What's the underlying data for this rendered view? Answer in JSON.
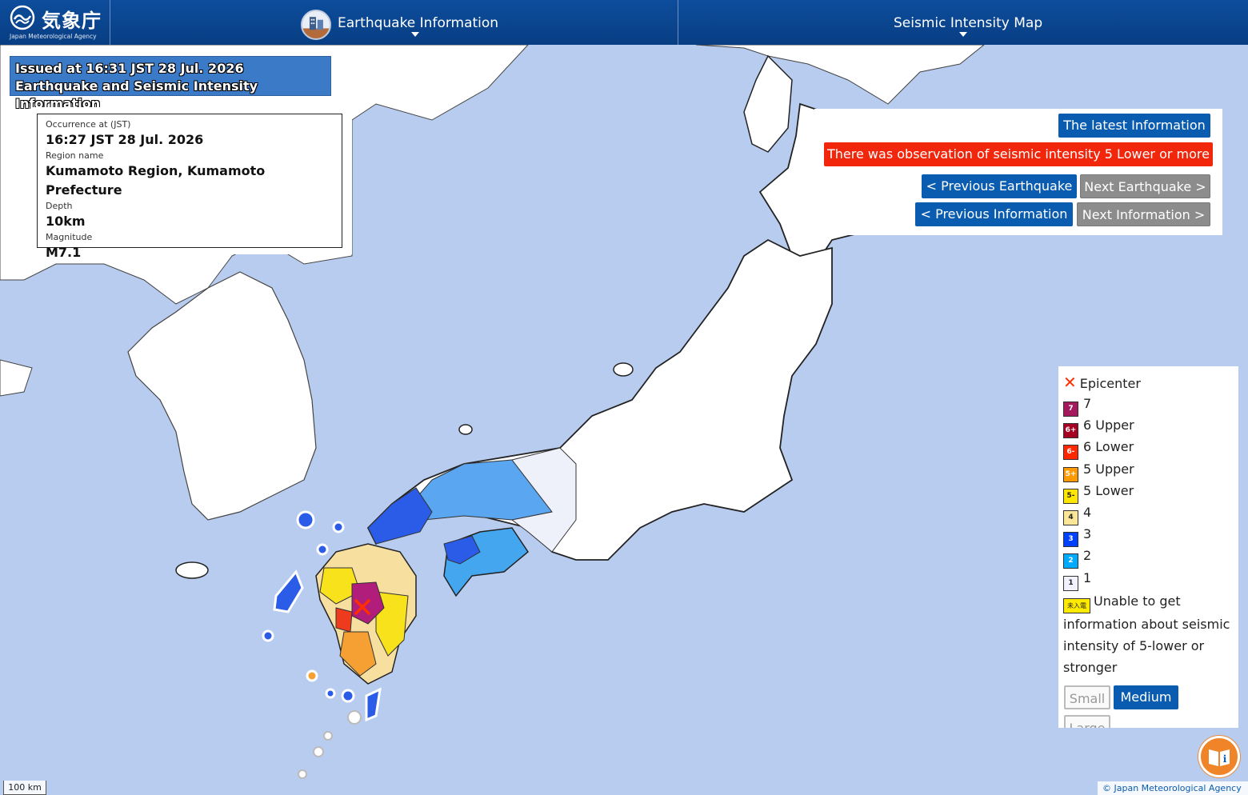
{
  "header": {
    "logo_kanji": "気象庁",
    "logo_en": "Japan Meteorological Agency",
    "tab_earthquake": "Earthquake Information",
    "tab_map": "Seismic Intensity Map"
  },
  "issued": {
    "line1": "Issued at 16:31 JST 28 Jul. 2026",
    "line2": "Earthquake and Seismic Intensity Information"
  },
  "info": {
    "occurrence_label": "Occurrence at (JST)",
    "occurrence_value": "16:27 JST 28 Jul. 2026",
    "region_label": "Region name",
    "region_value": "Kumamoto Region, Kumamoto Prefecture",
    "depth_label": "Depth",
    "depth_value": "10km",
    "magnitude_label": "Magnitude",
    "magnitude_value": "M7.1"
  },
  "nav": {
    "latest": "The latest Information",
    "alert": "There was observation of seismic intensity 5 Lower or more",
    "prev_eq": "< Previous Earthquake",
    "next_eq": "Next Earthquake >",
    "prev_info": "< Previous Information",
    "next_info": "Next Information >"
  },
  "legend": {
    "epicenter": "Epicenter",
    "items": [
      {
        "badge": "7",
        "label": "7",
        "color": "#a3195b",
        "text": "#ffffff"
      },
      {
        "badge": "6+",
        "label": "6 Upper",
        "color": "#a50021",
        "text": "#ffffff"
      },
      {
        "badge": "6-",
        "label": "6 Lower",
        "color": "#ff2800",
        "text": "#ffffff"
      },
      {
        "badge": "5+",
        "label": "5 Upper",
        "color": "#ff9900",
        "text": "#ffffff"
      },
      {
        "badge": "5-",
        "label": "5 Lower",
        "color": "#ffe600",
        "text": "#222222"
      },
      {
        "badge": "4",
        "label": "4",
        "color": "#fae696",
        "text": "#222222"
      },
      {
        "badge": "3",
        "label": "3",
        "color": "#0041ff",
        "text": "#ffffff"
      },
      {
        "badge": "2",
        "label": "2",
        "color": "#00aaff",
        "text": "#ffffff"
      },
      {
        "badge": "1",
        "label": "1",
        "color": "#f2f2ff",
        "text": "#222222"
      }
    ],
    "unknown_badge": "未入電",
    "unknown_text": "Unable to get information about seismic intensity of 5-lower or stronger",
    "size_small": "Small",
    "size_medium": "Medium",
    "size_large": "Large"
  },
  "map": {
    "scale": "100 km",
    "credit": "© Japan Meteorological Agency"
  },
  "colors": {
    "header": "#0a4a96",
    "sea": "#b8ccef",
    "accent_blue": "#0a5cb0",
    "alert_red": "#f2260b",
    "help_orange": "#f08428"
  }
}
